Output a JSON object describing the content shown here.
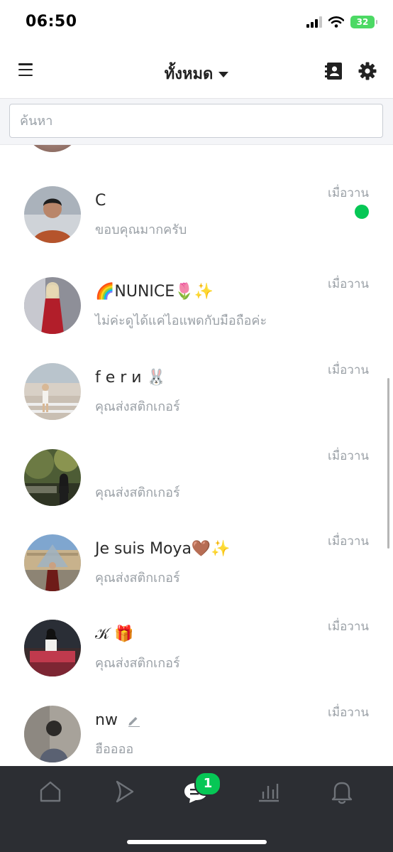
{
  "status_bar": {
    "time": "06:50",
    "battery": "32"
  },
  "header": {
    "title": "ทั้งหมด"
  },
  "search": {
    "placeholder": "ค้นหา"
  },
  "chats": [
    {
      "name": "C",
      "preview": "ขอบคุณมากครับ",
      "time": "เมื่อวาน",
      "unread": true
    },
    {
      "name": "🌈NUNICE🌷✨",
      "preview": "ไม่ค่ะดูได้แค่ไอแพดกับมือถือค่ะ",
      "time": "เมื่อวาน",
      "unread": false
    },
    {
      "name": "f e r и 🐰",
      "preview": "คุณส่งสติกเกอร์",
      "time": "เมื่อวาน",
      "unread": false
    },
    {
      "name": "",
      "preview": "คุณส่งสติกเกอร์",
      "time": "เมื่อวาน",
      "unread": false
    },
    {
      "name": "Je suis Moya🤎✨",
      "preview": "คุณส่งสติกเกอร์",
      "time": "เมื่อวาน",
      "unread": false
    },
    {
      "name": "𝒦 🎁",
      "preview": "คุณส่งสติกเกอร์",
      "time": "เมื่อวาน",
      "unread": false
    },
    {
      "name": "nw",
      "preview": "ฮืออออ",
      "time": "เมื่อวาน",
      "unread": false
    }
  ],
  "bottom_nav": {
    "items": [
      "home-icon",
      "voom-icon",
      "chat-icon",
      "stats-icon",
      "bell-icon"
    ],
    "chat_badge": "1"
  },
  "colors": {
    "accent": "#06c755",
    "nav_bg": "#2c2e33",
    "muted_text": "#9aa0a6"
  }
}
